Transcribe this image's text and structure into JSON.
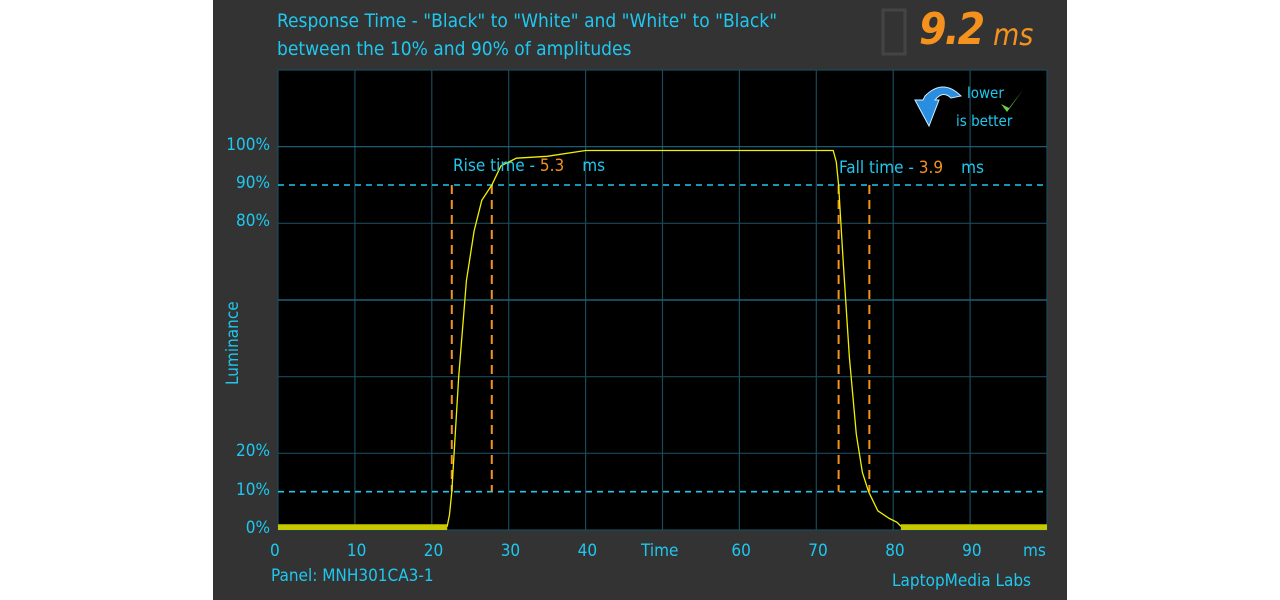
{
  "chart_data": {
    "type": "line",
    "title": "Response Time - \"Black\" to \"White\" and \"White\" to \"Black\"",
    "subtitle": "between the 10% and 90% of amplitudes",
    "xlabel": "Time",
    "xunit": "ms",
    "ylabel": "Luminance",
    "xlim": [
      0,
      100
    ],
    "ylim": [
      0,
      120
    ],
    "xticks": [
      "0",
      "10",
      "20",
      "30",
      "40",
      "60",
      "70",
      "80",
      "90"
    ],
    "xtick_values": [
      0,
      10,
      20,
      30,
      40,
      60,
      70,
      80,
      90
    ],
    "yticks": [
      {
        "label": "100%",
        "v": 100
      },
      {
        "label": "90%",
        "v": 90
      },
      {
        "label": "80%",
        "v": 80
      },
      {
        "label": "20%",
        "v": 20
      },
      {
        "label": "10%",
        "v": 10
      },
      {
        "label": "0%",
        "v": 0
      }
    ],
    "grid": true,
    "threshold_lines": [
      90,
      10
    ],
    "series": [
      {
        "color": "#f0f000",
        "points": [
          [
            0,
            1
          ],
          [
            22,
            1
          ],
          [
            22.3,
            4
          ],
          [
            22.6,
            10
          ],
          [
            23.5,
            40
          ],
          [
            24.5,
            65
          ],
          [
            25.5,
            78
          ],
          [
            26.5,
            86
          ],
          [
            27.8,
            90
          ],
          [
            29,
            95
          ],
          [
            31,
            97
          ],
          [
            35,
            97.5
          ],
          [
            40,
            99
          ],
          [
            50,
            99
          ],
          [
            60,
            99
          ],
          [
            72.2,
            99
          ],
          [
            72.6,
            96
          ],
          [
            72.9,
            90
          ],
          [
            73.5,
            70
          ],
          [
            74.3,
            45
          ],
          [
            75.2,
            25
          ],
          [
            76,
            15
          ],
          [
            76.8,
            10
          ],
          [
            78,
            5
          ],
          [
            79.5,
            3
          ],
          [
            80.5,
            2
          ],
          [
            81,
            1
          ],
          [
            100,
            1
          ]
        ]
      }
    ],
    "rise": {
      "label": "Rise time - ",
      "value": "5.3",
      "unit": "ms",
      "start": 22.6,
      "end": 27.8
    },
    "fall": {
      "label": "Fall time - ",
      "value": "3.9",
      "unit": "ms",
      "start": 72.9,
      "end": 76.9
    },
    "total": {
      "value": "9.2",
      "unit": "ms"
    },
    "badge": {
      "line1": "lower",
      "line2": "is better"
    },
    "panel": "Panel: MNH301CA3-1",
    "brand": "LaptopMedia Labs",
    "colors": {
      "accent": "#1ec8f0",
      "orange": "#f5921e",
      "trace": "#f0f000",
      "grid": "#1a4a5a"
    }
  }
}
